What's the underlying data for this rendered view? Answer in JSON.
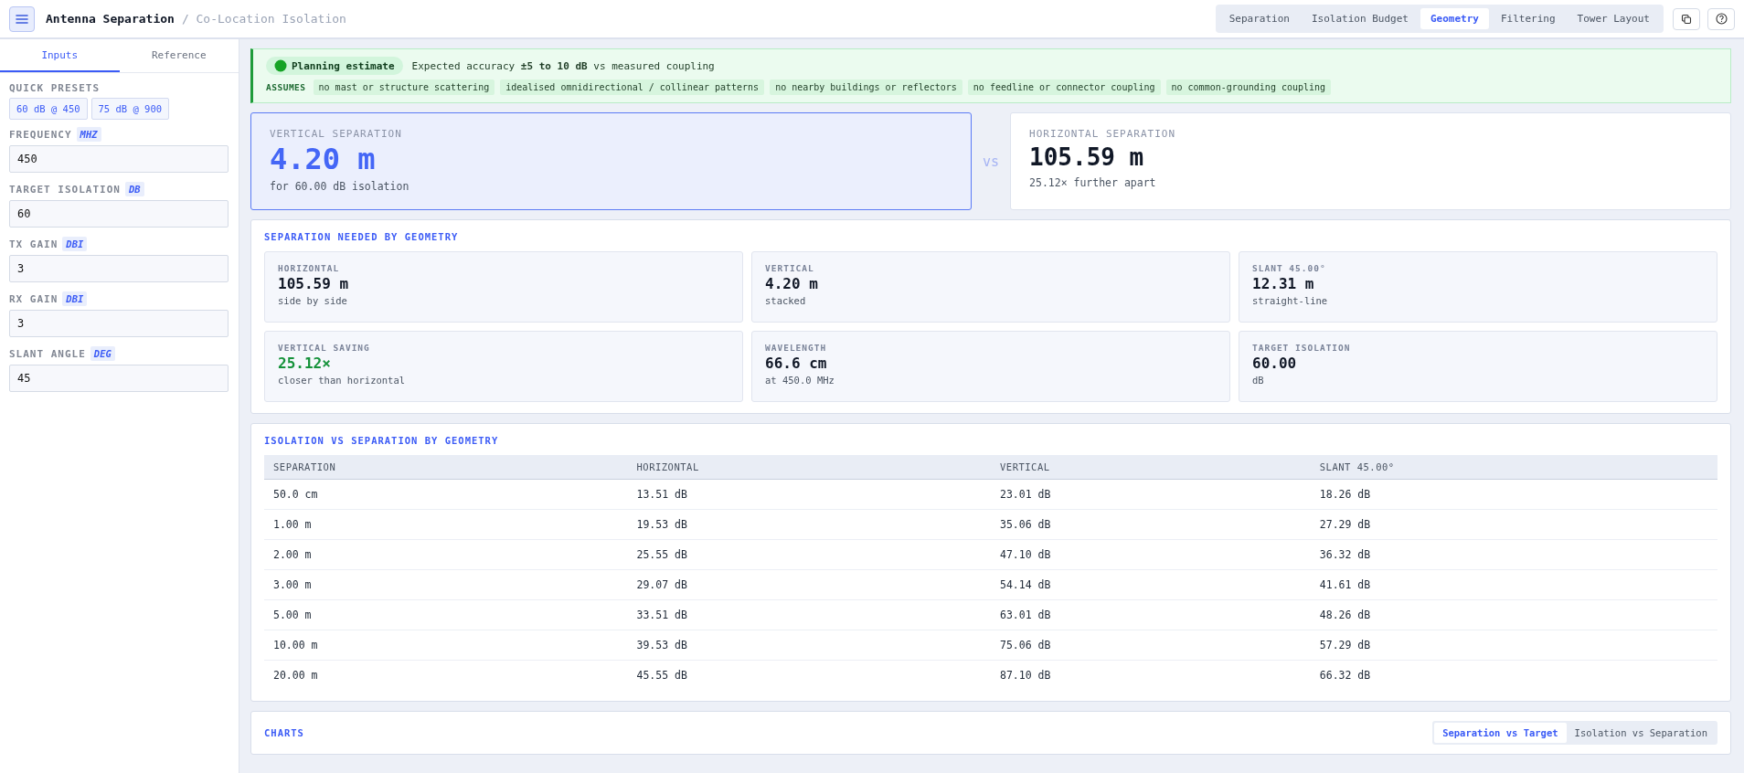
{
  "header": {
    "title": "Antenna Separation",
    "subtitle": "/ Co-Location Isolation"
  },
  "nav_tabs": [
    {
      "label": "Separation",
      "selected": false
    },
    {
      "label": "Isolation Budget",
      "selected": false
    },
    {
      "label": "Geometry",
      "selected": true
    },
    {
      "label": "Filtering",
      "selected": false
    },
    {
      "label": "Tower Layout",
      "selected": false
    }
  ],
  "sidebar": {
    "tabs": [
      {
        "label": "Inputs",
        "selected": true
      },
      {
        "label": "Reference",
        "selected": false
      }
    ],
    "presets_label": "QUICK PRESETS",
    "presets": [
      "60 dB @ 450",
      "75 dB @ 900"
    ],
    "fields": [
      {
        "label": "FREQUENCY",
        "unit": "MHZ",
        "value": "450"
      },
      {
        "label": "TARGET ISOLATION",
        "unit": "DB",
        "value": "60"
      },
      {
        "label": "TX GAIN",
        "unit": "DBI",
        "value": "3"
      },
      {
        "label": "RX GAIN",
        "unit": "DBI",
        "value": "3"
      },
      {
        "label": "SLANT ANGLE",
        "unit": "DEG",
        "value": "45"
      }
    ]
  },
  "banner": {
    "badge": "Planning estimate",
    "accuracy": "Expected accuracy **±5 to 10 dB** vs measured coupling",
    "assumes_label": "ASSUMES",
    "assumptions": [
      "no mast or structure scattering",
      "idealised omnidirectional / collinear patterns",
      "no nearby buildings or reflectors",
      "no feedline or connector coupling",
      "no common-grounding coupling"
    ]
  },
  "hero": {
    "vs": "vs",
    "cards": [
      {
        "label": "VERTICAL SEPARATION",
        "value": "4.20 m",
        "note": "for 60.00 dB isolation",
        "highlighted": true
      },
      {
        "label": "HORIZONTAL SEPARATION",
        "value": "105.59 m",
        "note": "25.12× further apart",
        "highlighted": false
      }
    ]
  },
  "geometry": {
    "title": "SEPARATION NEEDED BY GEOMETRY",
    "cards": [
      {
        "label": "HORIZONTAL",
        "value": "105.59 m",
        "note": "side by side",
        "kind": "plain"
      },
      {
        "label": "VERTICAL",
        "value": "4.20 m",
        "note": "stacked",
        "kind": "plain"
      },
      {
        "label": "SLANT 45.00°",
        "value": "12.31 m",
        "note": "straight-line",
        "kind": "plain"
      },
      {
        "label": "VERTICAL SAVING",
        "value": "25.12×",
        "note": "closer than horizontal",
        "kind": "good"
      },
      {
        "label": "WAVELENGTH",
        "value": "66.6 cm",
        "note": "at 450.0 MHz",
        "kind": "plain"
      },
      {
        "label": "TARGET ISOLATION",
        "value": "60.00",
        "note": "dB",
        "kind": "plain"
      }
    ]
  },
  "table": {
    "title": "ISOLATION VS SEPARATION BY GEOMETRY",
    "columns": [
      "SEPARATION",
      "HORIZONTAL",
      "VERTICAL",
      "SLANT 45.00°"
    ],
    "rows": [
      [
        "50.0 cm",
        "13.51 dB",
        "23.01 dB",
        "18.26 dB"
      ],
      [
        "1.00 m",
        "19.53 dB",
        "35.06 dB",
        "27.29 dB"
      ],
      [
        "2.00 m",
        "25.55 dB",
        "47.10 dB",
        "36.32 dB"
      ],
      [
        "3.00 m",
        "29.07 dB",
        "54.14 dB",
        "41.61 dB"
      ],
      [
        "5.00 m",
        "33.51 dB",
        "63.01 dB",
        "48.26 dB"
      ],
      [
        "10.00 m",
        "39.53 dB",
        "75.06 dB",
        "57.29 dB"
      ],
      [
        "20.00 m",
        "45.55 dB",
        "87.10 dB",
        "66.32 dB"
      ]
    ]
  },
  "charts": {
    "title": "CHARTS",
    "toggles": [
      {
        "label": "Separation vs Target",
        "selected": true
      },
      {
        "label": "Isolation vs Separation",
        "selected": false
      }
    ]
  }
}
